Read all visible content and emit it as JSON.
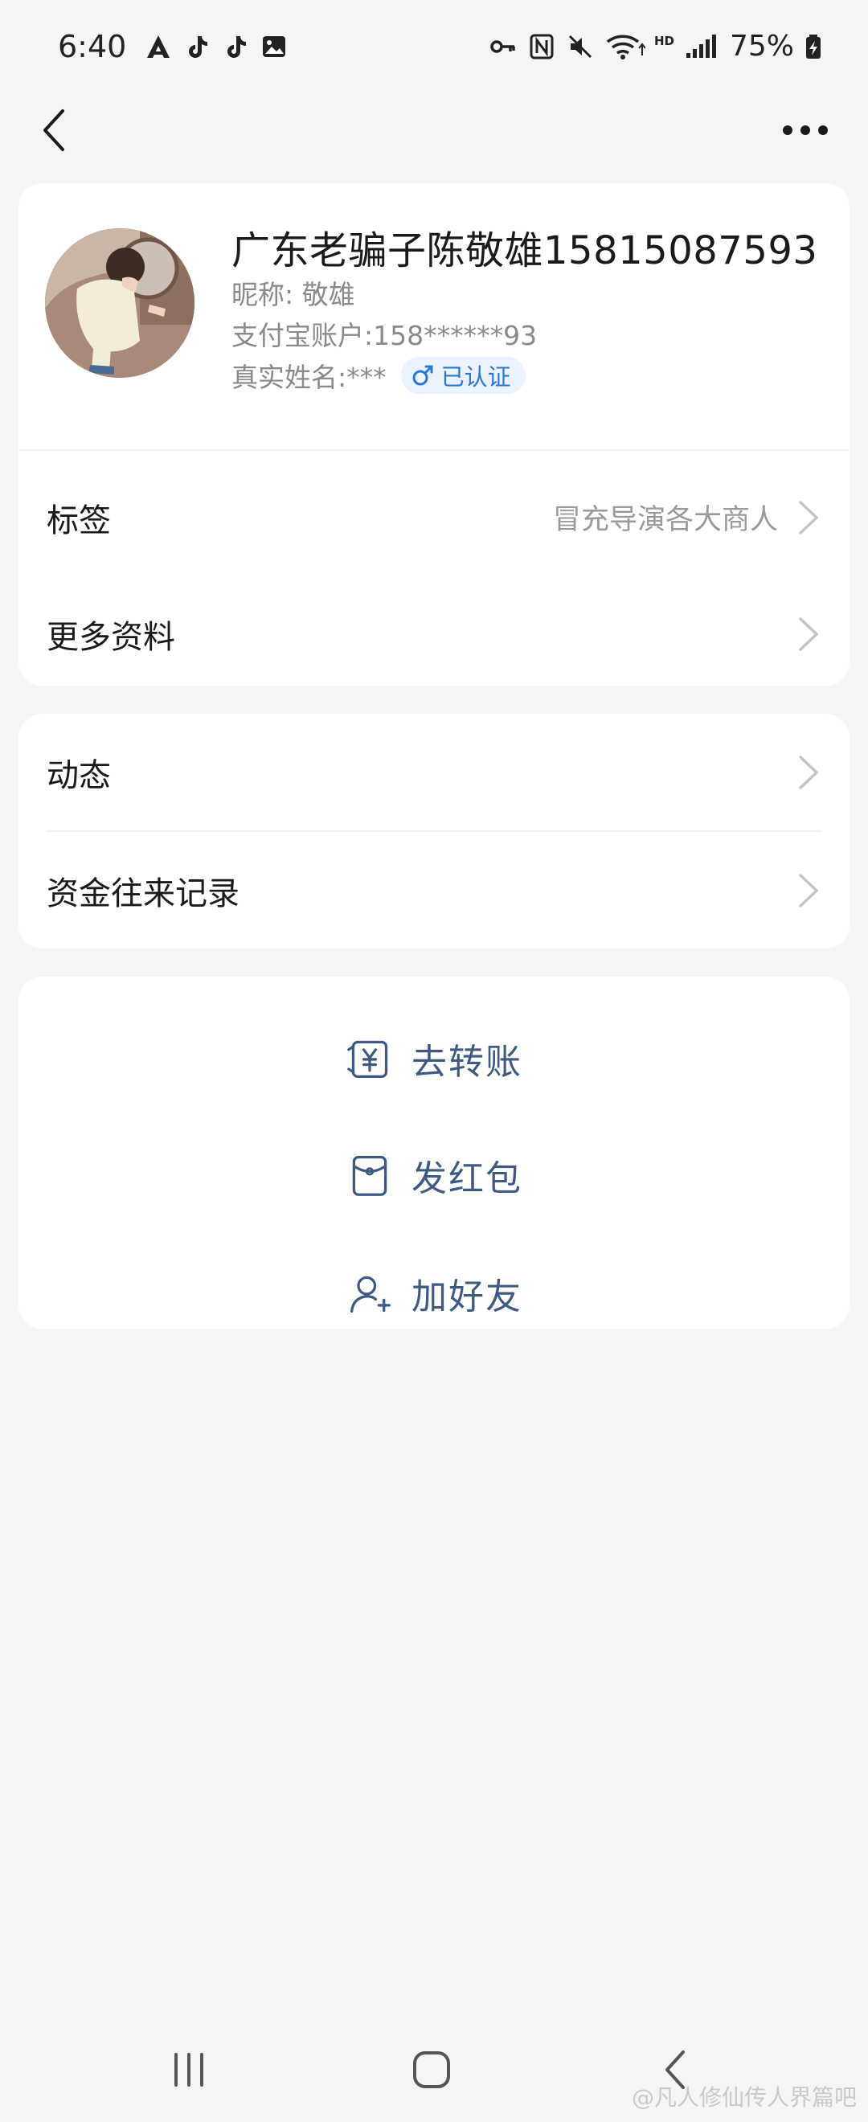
{
  "status_bar": {
    "time": "6:40",
    "left_icons": [
      "a-icon",
      "tiktok-icon",
      "tiktok-icon",
      "gallery-icon"
    ],
    "right_icons": [
      "key-icon",
      "nfc-icon",
      "mute-icon",
      "wifi-icon",
      "hd-signal-icon"
    ],
    "battery": "75%"
  },
  "profile": {
    "name": "广东老骗子陈敬雄15815087593",
    "nickname": "昵称: 敬雄",
    "account": "支付宝账户:158******93",
    "real_name": "真实姓名:***",
    "verified_label": "已认证",
    "gender_symbol": "♂"
  },
  "rows": {
    "tags": {
      "label": "标签",
      "value": "冒充导演各大商人"
    },
    "more_info": {
      "label": "更多资料"
    },
    "moments": {
      "label": "动态"
    },
    "funds": {
      "label": "资金往来记录"
    }
  },
  "actions": {
    "transfer": "去转账",
    "red_packet": "发红包",
    "add_friend": "加好友"
  },
  "watermark": "@凡人修仙传人界篇吧",
  "colors": {
    "background": "#f5f5f5",
    "card": "#ffffff",
    "action_text": "#3f5a82",
    "badge_bg": "#eaf3ff",
    "badge_text": "#2a77d8"
  }
}
